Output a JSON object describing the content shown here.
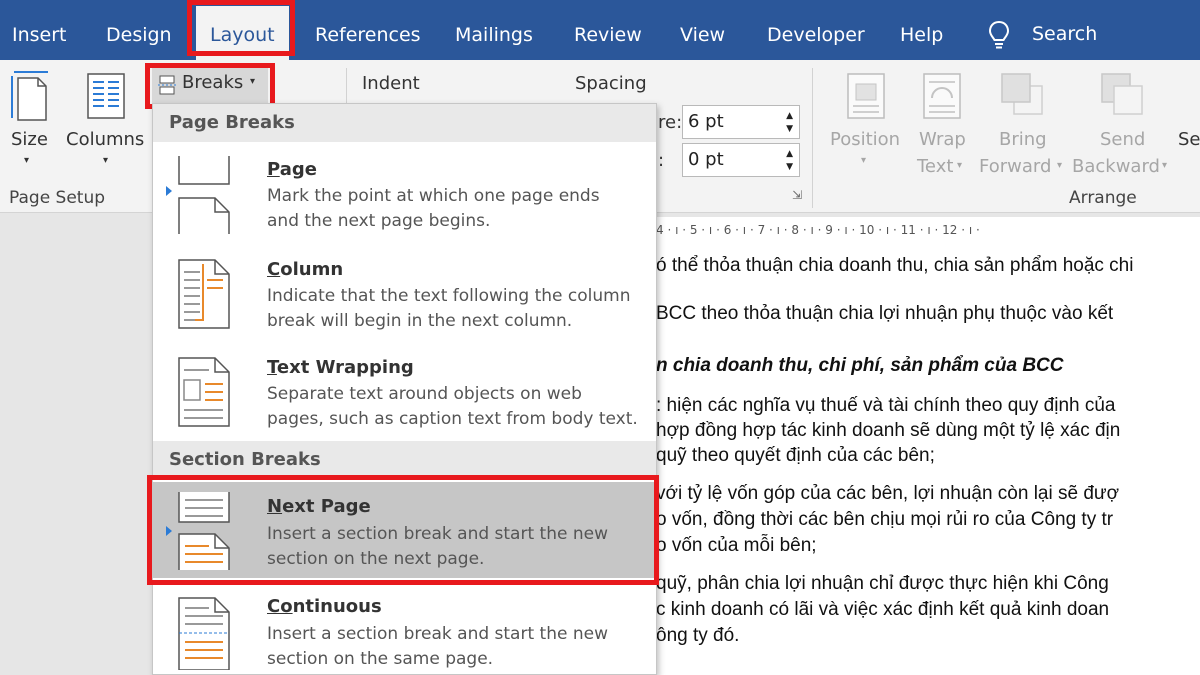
{
  "tabs": [
    {
      "label": "Insert",
      "active": false
    },
    {
      "label": "Design",
      "active": false
    },
    {
      "label": "Layout",
      "active": true
    },
    {
      "label": "References",
      "active": false
    },
    {
      "label": "Mailings",
      "active": false
    },
    {
      "label": "Review",
      "active": false
    },
    {
      "label": "View",
      "active": false
    },
    {
      "label": "Developer",
      "active": false
    },
    {
      "label": "Help",
      "active": false
    }
  ],
  "search_label": "Search",
  "ribbon": {
    "size_label": "Size",
    "columns_label": "Columns",
    "page_setup_label": "Page Setup",
    "breaks_label": "Breaks",
    "indent_label": "Indent",
    "spacing_label": "Spacing",
    "before_label_frag": "re:",
    "after_label_frag": ":",
    "spacing_before_value": "6 pt",
    "spacing_after_value": "0 pt",
    "position_label": "Position",
    "wrap_label_1": "Wrap",
    "wrap_label_2": "Text",
    "bring_label_1": "Bring",
    "bring_label_2": "Forward",
    "send_label_1": "Send",
    "send_label_2": "Backward",
    "sel_label_frag": "Se",
    "arrange_label": "Arrange"
  },
  "ruler_text": "4 · ı · 5 · ı · 6 · ı · 7 · ı · 8 · ı · 9 · ı · 10 · ı · 11 · ı · 12 · ı ·",
  "document_lines": [
    {
      "text": "ó thể thỏa thuận chia doanh thu, chia sản phẩm hoặc chi",
      "style": "normal"
    },
    {
      "text": "BCC theo thỏa thuận chia lợi nhuận phụ thuộc vào kết",
      "style": "normal"
    },
    {
      "text": "n chia doanh thu, chi phí, sản phẩm của BCC",
      "style": "bi"
    },
    {
      "text": ": hiện các nghĩa vụ thuế và tài chính theo quy định của",
      "style": "normal"
    },
    {
      "text": "hợp đồng hợp tác kinh doanh sẽ dùng một tỷ lệ xác địn",
      "style": "normal"
    },
    {
      "text": "quỹ theo quyết định của các bên;",
      "style": "normal"
    },
    {
      "text": "với tỷ lệ vốn góp của các bên, lợi nhuận còn lại sẽ đượ",
      "style": "normal"
    },
    {
      "text": "o vốn, đồng thời các bên chịu mọi rủi ro của Công ty tr",
      "style": "normal"
    },
    {
      "text": "o vốn của mỗi bên;",
      "style": "normal"
    },
    {
      "text": "quỹ, phân chia lợi nhuận chỉ được thực hiện khi Công",
      "style": "normal"
    },
    {
      "text": "c kinh doanh có lãi và việc xác định kết quả kinh doan",
      "style": "normal"
    },
    {
      "text": "ông ty đó.",
      "style": "normal"
    }
  ],
  "dropdown": {
    "page_breaks_header": "Page Breaks",
    "section_breaks_header": "Section Breaks",
    "items": [
      {
        "title_u": "P",
        "title_rest": "age",
        "desc1": "Mark the point at which one page ends",
        "desc2": "and the next page begins.",
        "icon": "page-break-icon"
      },
      {
        "title_u": "C",
        "title_rest": "olumn",
        "desc1": "Indicate that the text following the column",
        "desc2": "break will begin in the next column.",
        "icon": "column-break-icon"
      },
      {
        "title_u": "T",
        "title_rest": "ext Wrapping",
        "desc1": "Separate text around objects on web",
        "desc2": "pages, such as caption text from body text.",
        "icon": "text-wrapping-break-icon"
      },
      {
        "title_u": "N",
        "title_rest": "ext Page",
        "desc1": "Insert a section break and start the new",
        "desc2": "section on the next page.",
        "icon": "next-page-section-icon"
      },
      {
        "title_u": "Co",
        "title_rest": "ntinuous",
        "desc1": "Insert a section break and start the new",
        "desc2": "section on the same page.",
        "icon": "continuous-section-icon"
      }
    ]
  },
  "colors": {
    "ribbon_blue": "#2b579a",
    "highlight_red": "#e8191d",
    "menu_highlight": "#c6c6c6",
    "icon_orange": "#e8892b"
  }
}
